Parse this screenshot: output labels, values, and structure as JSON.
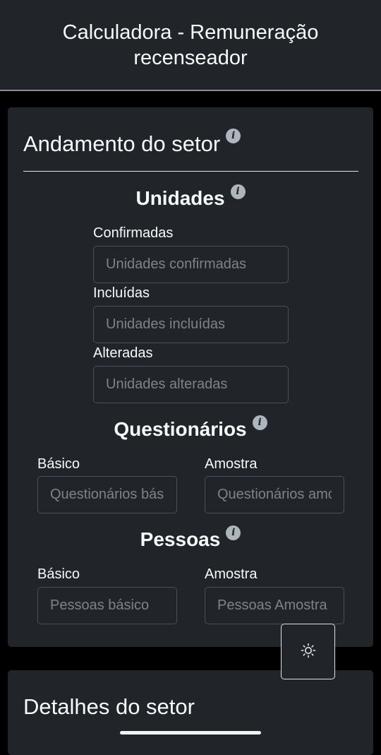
{
  "header": {
    "title": "Calculadora - Remuneração recenseador"
  },
  "progress_card": {
    "title": "Andamento do setor",
    "info_symbol": "i",
    "units": {
      "title": "Unidades",
      "confirmed": {
        "label": "Confirmadas",
        "placeholder": "Unidades confirmadas",
        "value": ""
      },
      "included": {
        "label": "Incluídas",
        "placeholder": "Unidades incluídas",
        "value": ""
      },
      "altered": {
        "label": "Alteradas",
        "placeholder": "Unidades alteradas",
        "value": ""
      }
    },
    "questionnaires": {
      "title": "Questionários",
      "basic": {
        "label": "Básico",
        "placeholder": "Questionários básico",
        "value": ""
      },
      "sample": {
        "label": "Amostra",
        "placeholder": "Questionários amostra",
        "value": ""
      }
    },
    "people": {
      "title": "Pessoas",
      "basic": {
        "label": "Básico",
        "placeholder": "Pessoas básico",
        "value": ""
      },
      "sample": {
        "label": "Amostra",
        "placeholder": "Pessoas Amostra",
        "value": ""
      }
    }
  },
  "details_card": {
    "title": "Detalhes do setor"
  },
  "theme_toggle": {
    "icon": "sun-icon"
  }
}
